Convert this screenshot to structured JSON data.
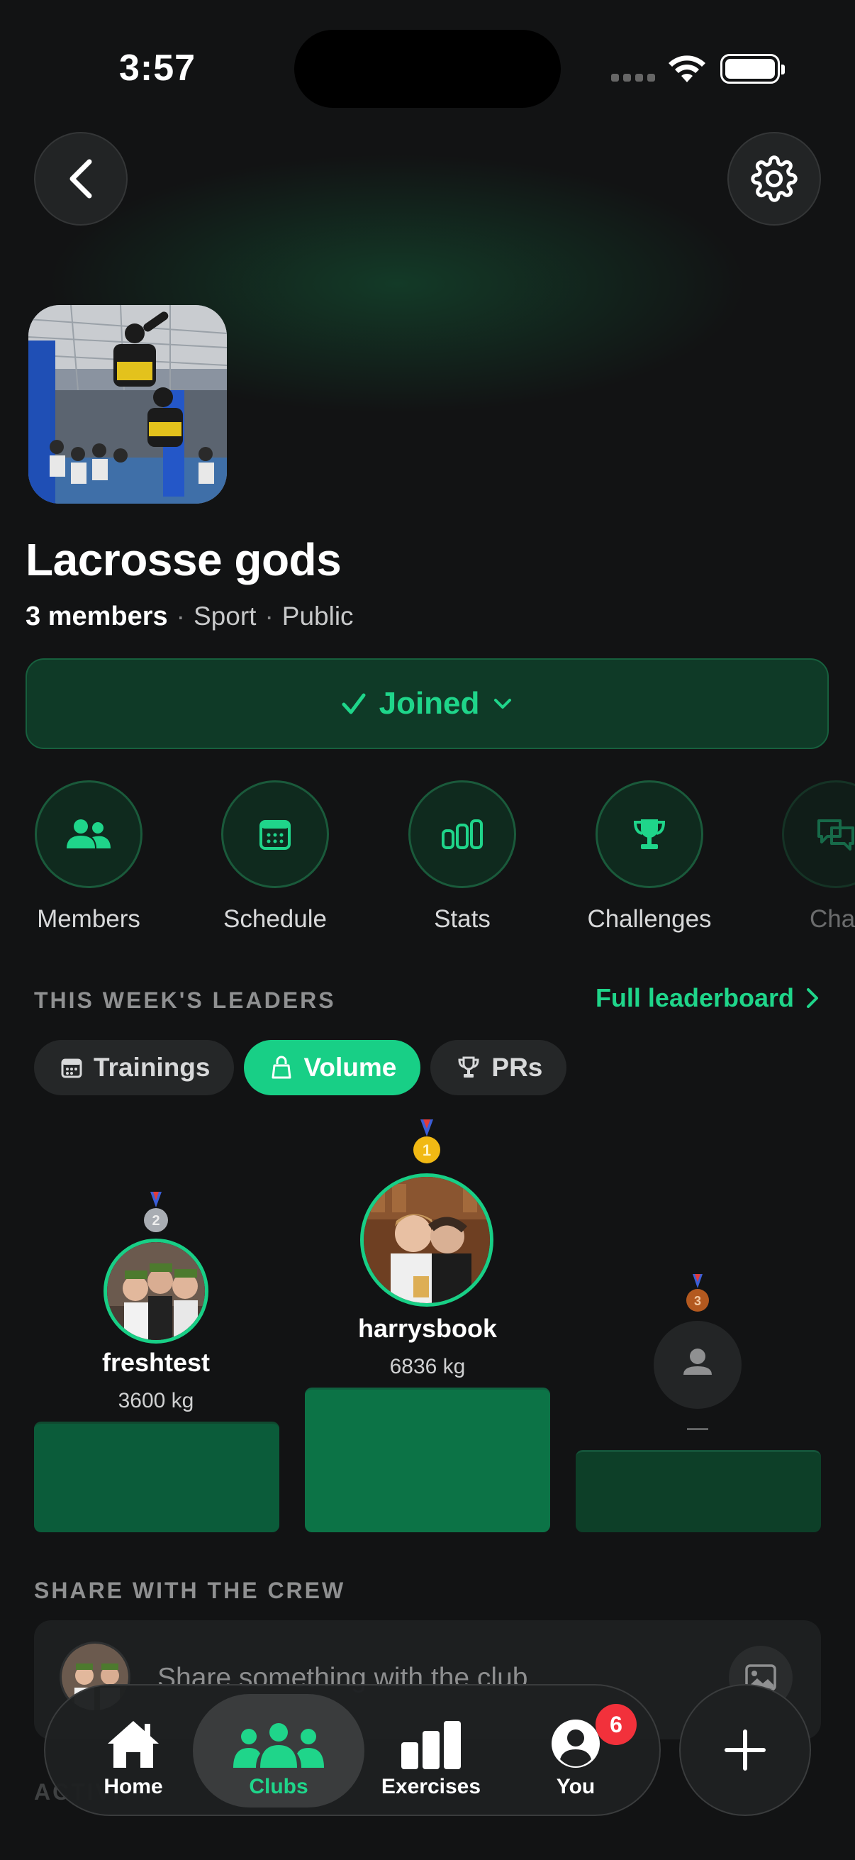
{
  "status_bar": {
    "time": "3:57"
  },
  "nav": {
    "back_icon": "chevron-left-icon",
    "settings_icon": "gear-icon"
  },
  "club": {
    "title": "Lacrosse gods",
    "members_count": "3 members",
    "category": "Sport",
    "visibility": "Public",
    "image_icon": "club-photo"
  },
  "membership": {
    "label": "Joined",
    "check_icon": "check-icon",
    "chevron_icon": "chevron-down-icon"
  },
  "actions": [
    {
      "label": "Members",
      "icon": "people-icon"
    },
    {
      "label": "Schedule",
      "icon": "calendar-icon"
    },
    {
      "label": "Stats",
      "icon": "bar-stats-icon"
    },
    {
      "label": "Challenges",
      "icon": "trophy-icon"
    },
    {
      "label": "Chat",
      "icon": "chat-icon"
    }
  ],
  "leaders": {
    "heading": "THIS WEEK'S LEADERS",
    "full_link": "Full leaderboard",
    "tabs": [
      {
        "label": "Trainings",
        "icon": "calendar-small-icon",
        "active": false
      },
      {
        "label": "Volume",
        "icon": "kettlebell-icon",
        "active": true
      },
      {
        "label": "PRs",
        "icon": "trophy-small-icon",
        "active": false
      }
    ],
    "podium": [
      {
        "rank": 2,
        "medal": "2",
        "name": "freshtest",
        "value": "3600 kg",
        "bar_color": "#0b5c3a"
      },
      {
        "rank": 1,
        "medal": "1",
        "name": "harrysbook",
        "value": "6836 kg",
        "bar_color": "#0c7346"
      },
      {
        "rank": 3,
        "medal": "3",
        "name": "—",
        "value": "",
        "bar_color": "#0d3f28"
      }
    ]
  },
  "share": {
    "heading": "SHARE WITH THE CREW",
    "placeholder": "Share something with the club"
  },
  "activity": {
    "heading": "ACTIVITY"
  },
  "tabbar": {
    "items": [
      {
        "label": "Home",
        "icon": "home-icon"
      },
      {
        "label": "Clubs",
        "icon": "group-icon",
        "active": true
      },
      {
        "label": "Exercises",
        "icon": "bars-icon"
      },
      {
        "label": "You",
        "icon": "profile-icon",
        "badge": "6"
      }
    ],
    "fab_icon": "plus-icon"
  },
  "colors": {
    "accent": "#1fd58a",
    "background": "#121314",
    "badge": "#f2313b"
  }
}
